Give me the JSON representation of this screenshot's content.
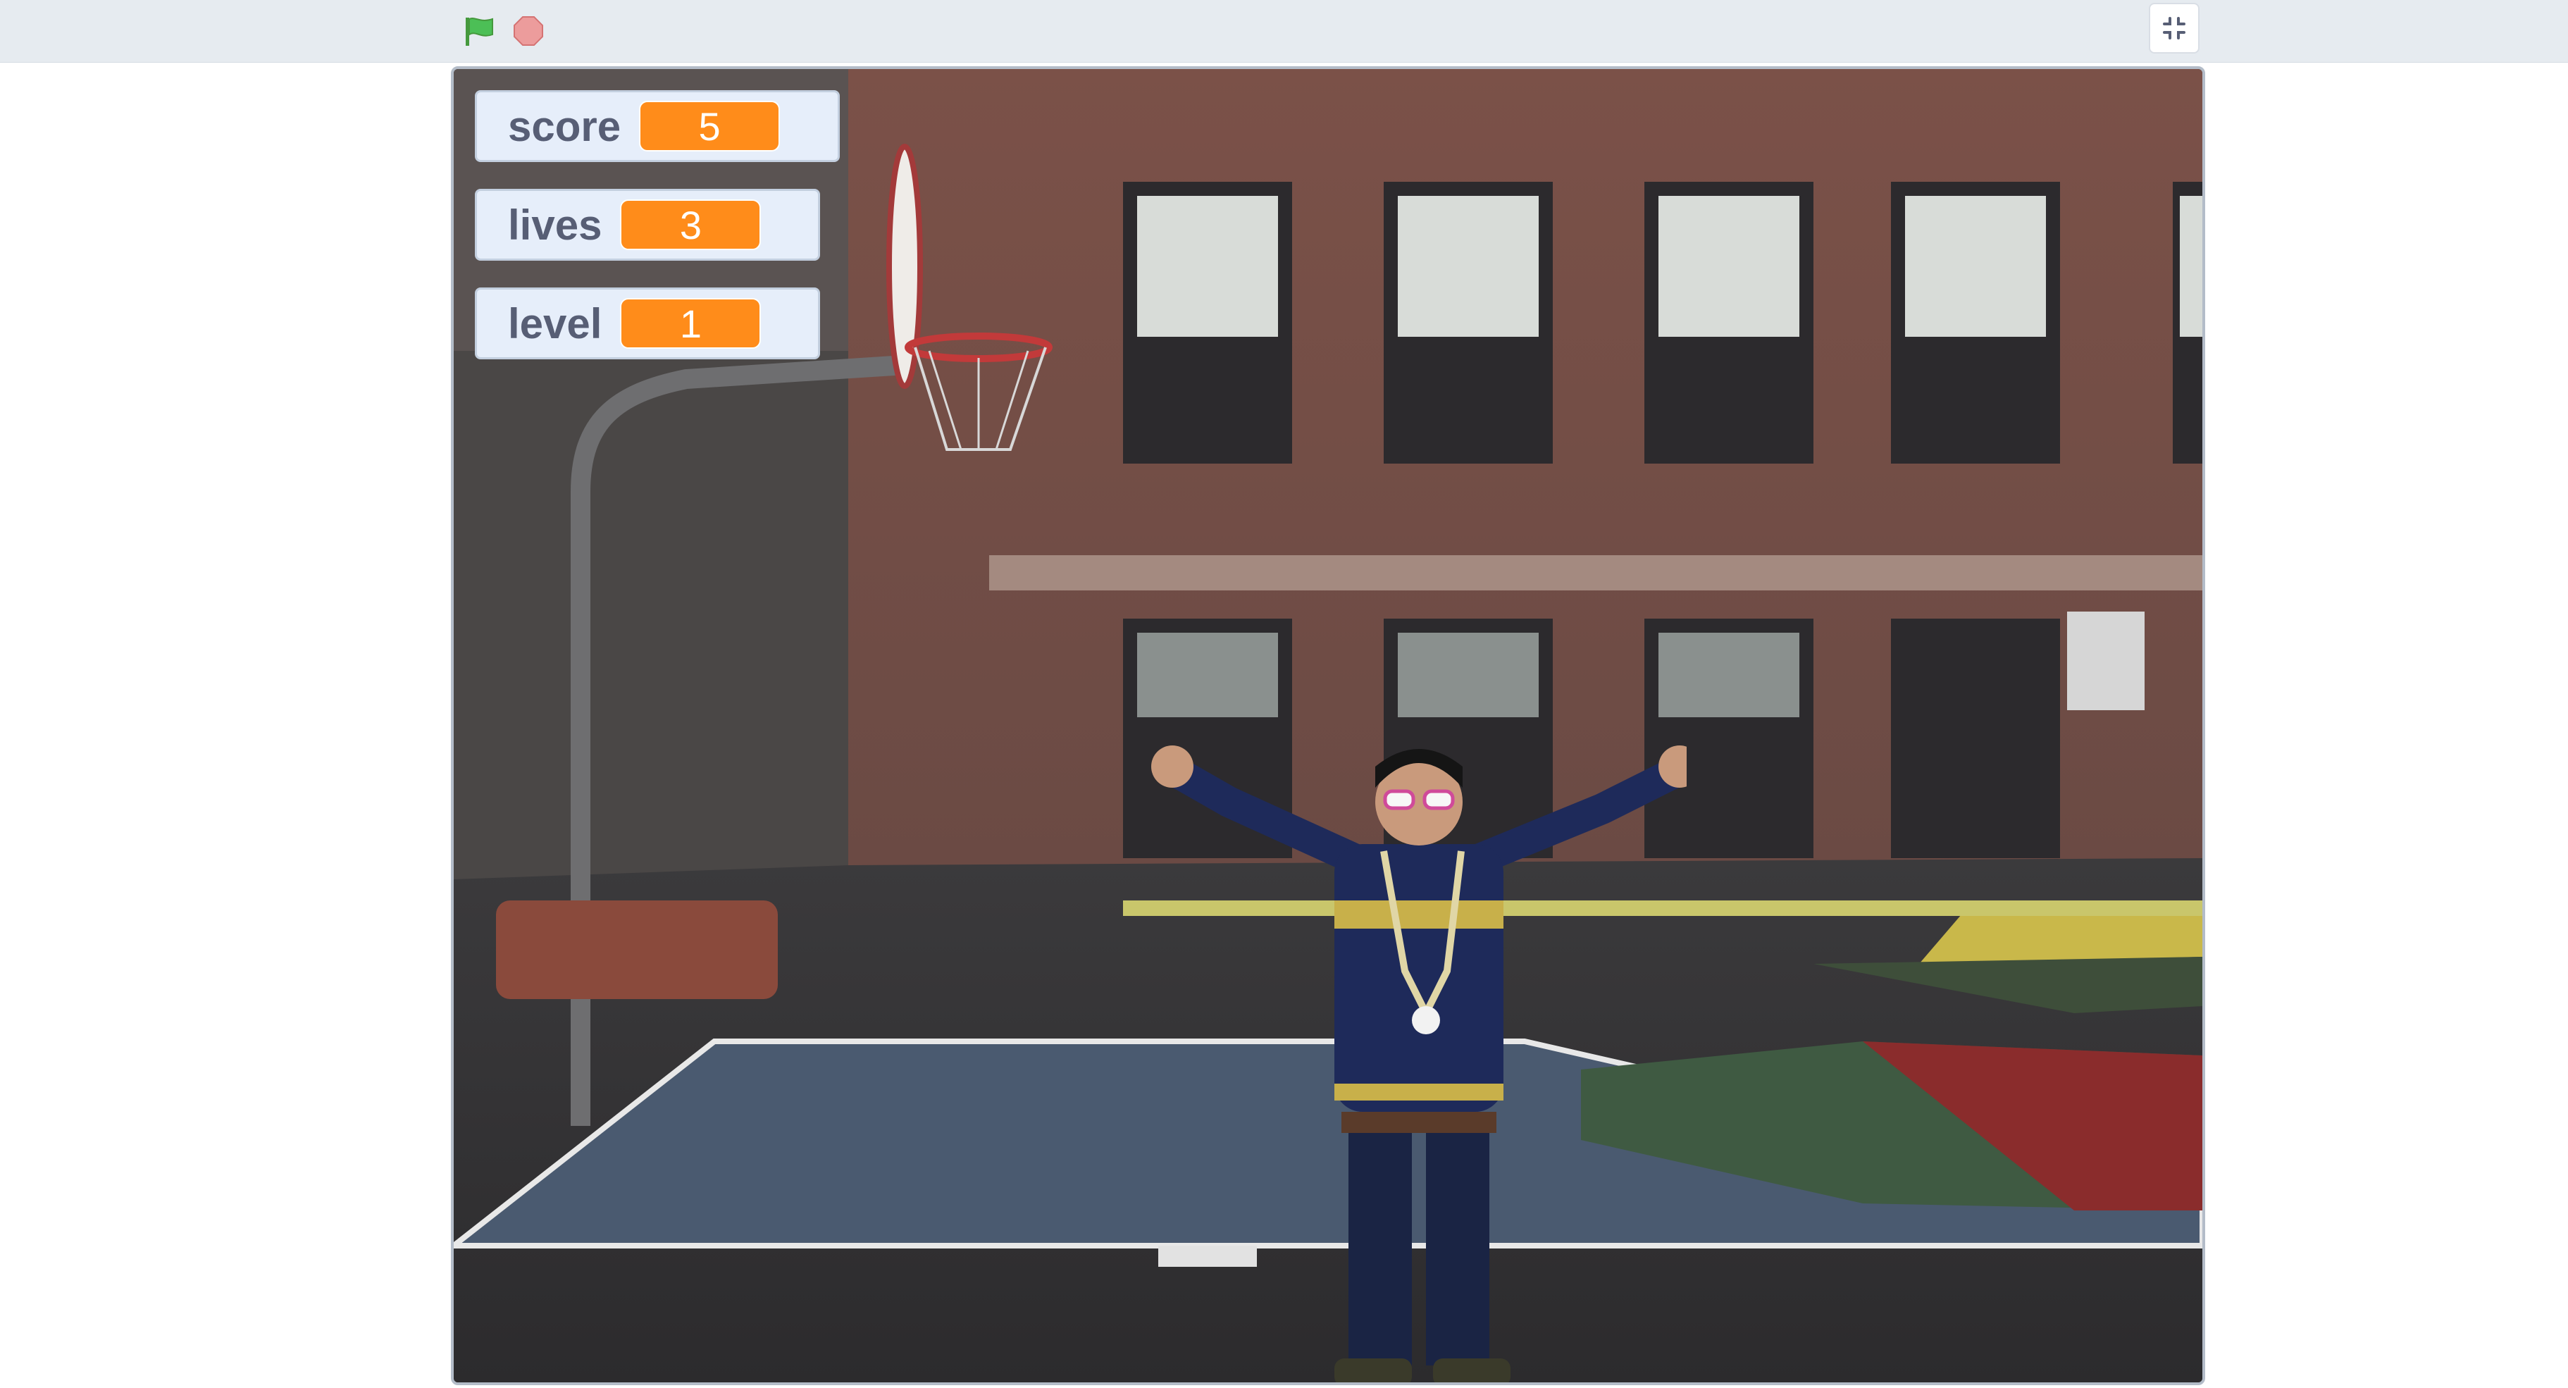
{
  "toolbar": {
    "green_flag_icon": "green-flag-icon",
    "stop_icon": "stop-sign-icon",
    "fullscreen_icon": "exit-fullscreen-icon"
  },
  "monitors": {
    "score": {
      "label": "score",
      "value": "5"
    },
    "lives": {
      "label": "lives",
      "value": "3"
    },
    "level": {
      "label": "level",
      "value": "1"
    }
  },
  "colors": {
    "monitor_value_bg": "#ff8c1a",
    "monitor_bg": "#e6eefa",
    "flag_green": "#4cbf56",
    "stop_red": "#ec9c9c"
  }
}
